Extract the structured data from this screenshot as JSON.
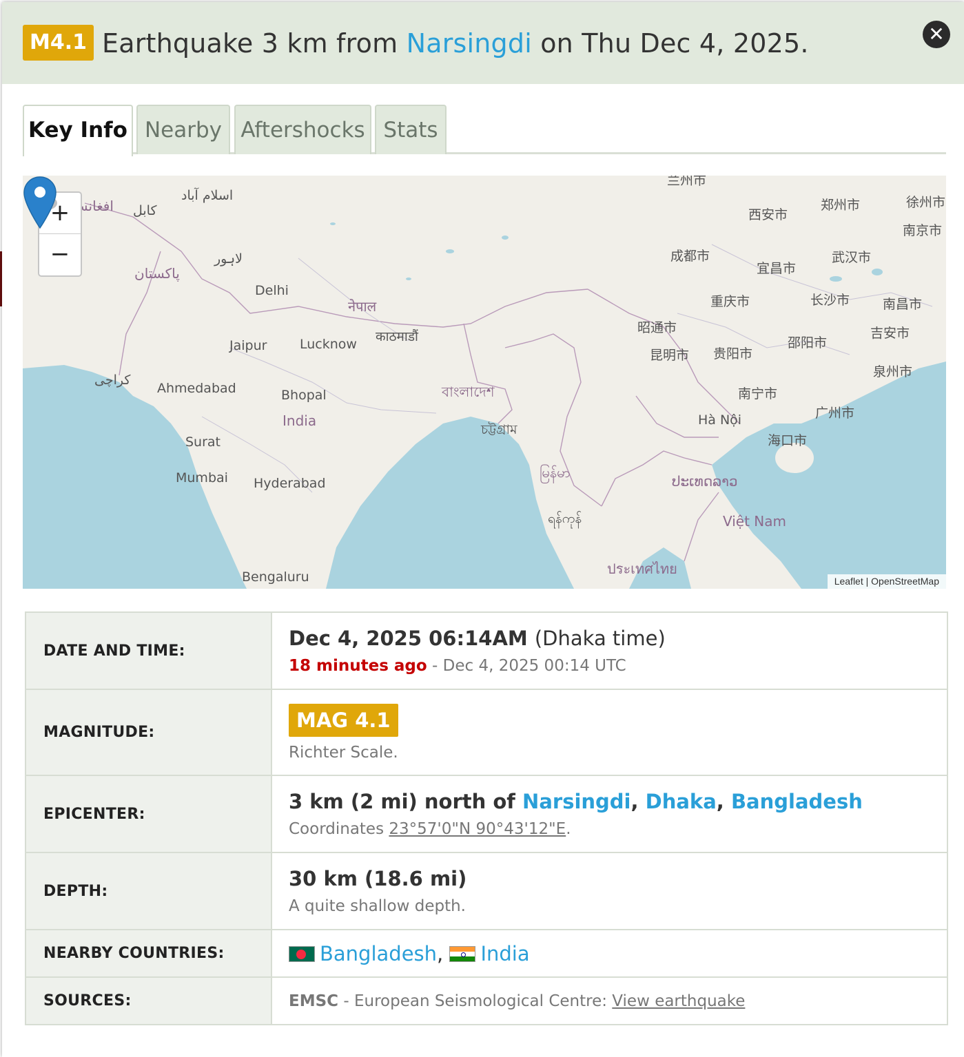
{
  "header": {
    "mag_badge": "M4.1",
    "title_prefix": "Earthquake 3 km from",
    "title_link": "Narsingdi",
    "title_suffix": "on Thu Dec 4, 2025."
  },
  "close_icon": "close-icon",
  "tabs": [
    {
      "label": "Key Info",
      "active": true
    },
    {
      "label": "Nearby",
      "active": false
    },
    {
      "label": "Aftershocks",
      "active": false
    },
    {
      "label": "Stats",
      "active": false
    }
  ],
  "map": {
    "zoom_in": "+",
    "zoom_out": "−",
    "attribution": "Leaflet | OpenStreetMap",
    "labels": {
      "afghanistan": "افغانس",
      "kabul": "کابل",
      "islamabad": "اسلام آباد",
      "lahore": "لاہور",
      "pakistan": "پاکستان",
      "karachi": "کراچی",
      "delhi": "Delhi",
      "jaipur": "Jaipur",
      "lucknow": "Lucknow",
      "nepal": "नेपाल",
      "kathmandu": "काठमाडौं",
      "ahmedabad": "Ahmedabad",
      "bhopal": "Bhopal",
      "india": "India",
      "surat": "Surat",
      "mumbai": "Mumbai",
      "hyderabad": "Hyderabad",
      "bengaluru": "Bengaluru",
      "bangladesh": "বাংলাদেশ",
      "chittagong": "চট্টগ্রাম",
      "myanmar": "မြန်မာ",
      "yangon": "ရန်ကုန်",
      "laos": "ປະເທດລາວ",
      "thailand": "ประเทศไทย",
      "vietnam": "Việt Nam",
      "hanoi": "Hà Nội",
      "xian": "西安市",
      "zhengzhou": "郑州市",
      "xuzhou": "徐州市",
      "nanjing": "南京市",
      "chengdu": "成都市",
      "yichang": "宜昌市",
      "wuhan": "武汉市",
      "chongqing": "重庆市",
      "changsha": "长沙市",
      "nanchang": "南昌市",
      "zhaotong": "昭通市",
      "kunming": "昆明市",
      "guiyang": "贵阳市",
      "shaoyang": "邵阳市",
      "jian": "吉安市",
      "quanzhou": "泉州市",
      "nanning": "南宁市",
      "guangzhou": "广州市",
      "haikou": "海口市",
      "lanzhou": "兰州市"
    },
    "marker_icon": "map-pin-icon",
    "colors": {
      "land": "#f1efe9",
      "water": "#aad3df",
      "marker": "#2a81cb"
    }
  },
  "info": {
    "date": {
      "label": "DATE AND TIME:",
      "local": "Dec 4, 2025 06:14AM",
      "local_tz": "(Dhaka time)",
      "ago": "18 minutes ago",
      "sep": "-",
      "utc": "Dec 4, 2025 00:14 UTC"
    },
    "magnitude": {
      "label": "MAGNITUDE:",
      "badge": "MAG 4.1",
      "scale": "Richter Scale."
    },
    "epicenter": {
      "label": "EPICENTER:",
      "distance": "3 km (2 mi) north of",
      "place1": "Narsingdi",
      "place2": "Dhaka",
      "place3": "Bangladesh",
      "comma": ",",
      "coords_label": "Coordinates",
      "coords": "23°57'0\"N 90°43'12\"E",
      "period": "."
    },
    "depth": {
      "label": "DEPTH:",
      "value": "30 km (18.6 mi)",
      "desc": "A quite shallow depth."
    },
    "countries": {
      "label": "NEARBY COUNTRIES:",
      "c1": "Bangladesh",
      "c2": "India",
      "comma": ","
    },
    "sources": {
      "label": "SOURCES:",
      "org": "EMSC",
      "desc": "- European Seismological Centre:",
      "link": "View earthquake"
    }
  },
  "colors": {
    "accent": "#2a9fd8",
    "mag": "#e0a70a",
    "header_bg": "#e1e9dd",
    "alert": "#c40000"
  }
}
